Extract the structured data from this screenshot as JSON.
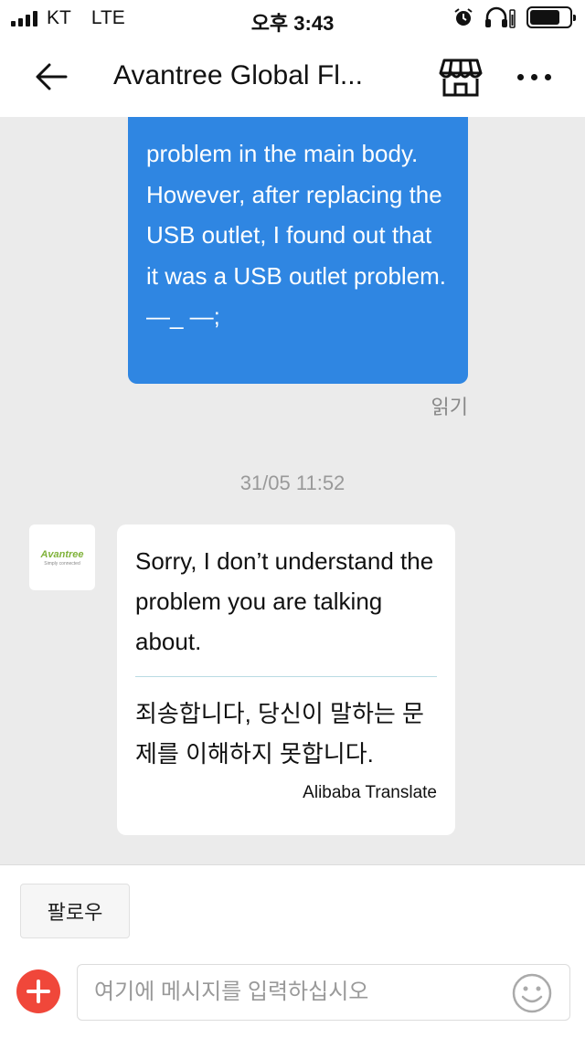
{
  "status_bar": {
    "carrier": "KT",
    "network": "LTE",
    "time": "오후 3:43",
    "icons": [
      "signal-icon",
      "alarm-icon",
      "headphones-icon",
      "battery-icon"
    ]
  },
  "nav": {
    "title": "Avantree Global Fl...",
    "icons": [
      "back-arrow-icon",
      "store-icon",
      "more-icon"
    ]
  },
  "messages": {
    "outgoing": {
      "text": "problem in the main body. However, after replacing the USB outlet, I found out that it was a USB outlet problem. —_ —;",
      "read_label": "읽기"
    },
    "timestamp": "31/05 11:52",
    "incoming": {
      "avatar_brand": "Avantree",
      "avatar_tagline": "Simply connected",
      "original": "Sorry, I don’t understand the problem you are talking about.",
      "translation": "죄송합니다, 당신이 말하는 문제를 이해하지 못합니다.",
      "translator": "Alibaba Translate"
    }
  },
  "bottom": {
    "follow_label": "팔로우",
    "input_placeholder": "여기에 메시지를 입력하십시오",
    "input_value": ""
  },
  "colors": {
    "outgoing_bubble": "#2f86e2",
    "plus_button": "#f0473a",
    "chat_background": "#ebebeb",
    "brand_green": "#7fb239"
  }
}
